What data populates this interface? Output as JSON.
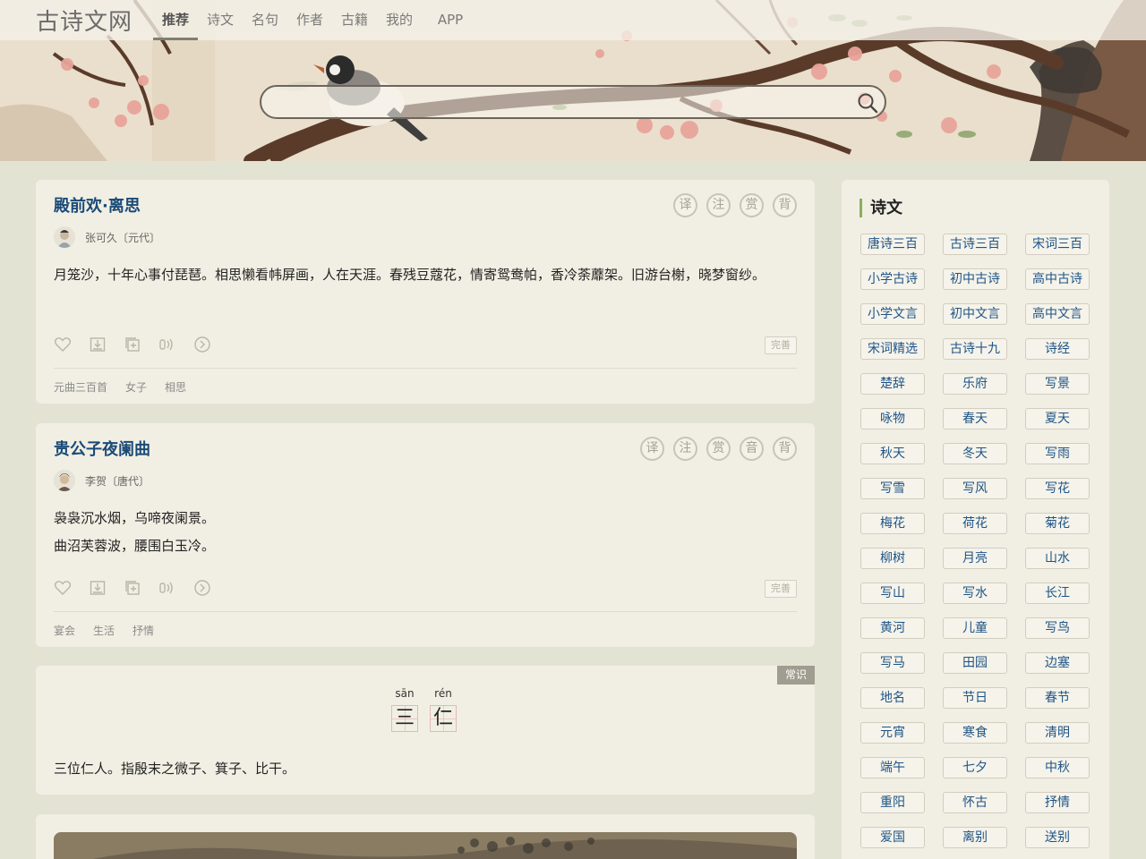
{
  "site": {
    "logo": "古诗文网",
    "search_placeholder": ""
  },
  "nav": [
    {
      "label": "推荐",
      "active": true
    },
    {
      "label": "诗文",
      "active": false
    },
    {
      "label": "名句",
      "active": false
    },
    {
      "label": "作者",
      "active": false
    },
    {
      "label": "古籍",
      "active": false
    },
    {
      "label": "我的",
      "active": false
    },
    {
      "label": "APP",
      "active": false
    }
  ],
  "poems": [
    {
      "title": "殿前欢·离思",
      "author": "张可久〔元代〕",
      "badges": [
        "译",
        "注",
        "赏",
        "背"
      ],
      "lines": [
        "月笼沙，十年心事付琵琶。相思懒看帏屏画，人在天涯。春残豆蔻花，情寄鸳鸯帕，香冷荼蘼架。旧游台榭，晓梦窗纱。"
      ],
      "wanshan": "完善",
      "tags": [
        "元曲三百首",
        "女子",
        "相思"
      ]
    },
    {
      "title": "贵公子夜阑曲",
      "author": "李贺〔唐代〕",
      "badges": [
        "译",
        "注",
        "赏",
        "音",
        "背"
      ],
      "lines": [
        "袅袅沉水烟，乌啼夜阑景。",
        "曲沼芙蓉波，腰围白玉冷。"
      ],
      "wanshan": "完善",
      "tags": [
        "宴会",
        "生活",
        "抒情"
      ]
    }
  ],
  "changshi": {
    "label": "常识",
    "chars": [
      {
        "pinyin": "sān",
        "hanzi": "三"
      },
      {
        "pinyin": "rén",
        "hanzi": "仁"
      }
    ],
    "text": "三位仁人。指殷末之微子、箕子、比干。"
  },
  "sidebar": {
    "title": "诗文",
    "tags": [
      "唐诗三百",
      "古诗三百",
      "宋词三百",
      "小学古诗",
      "初中古诗",
      "高中古诗",
      "小学文言",
      "初中文言",
      "高中文言",
      "宋词精选",
      "古诗十九",
      "诗经",
      "楚辞",
      "乐府",
      "写景",
      "咏物",
      "春天",
      "夏天",
      "秋天",
      "冬天",
      "写雨",
      "写雪",
      "写风",
      "写花",
      "梅花",
      "荷花",
      "菊花",
      "柳树",
      "月亮",
      "山水",
      "写山",
      "写水",
      "长江",
      "黄河",
      "儿童",
      "写鸟",
      "写马",
      "田园",
      "边塞",
      "地名",
      "节日",
      "春节",
      "元宵",
      "寒食",
      "清明",
      "端午",
      "七夕",
      "中秋",
      "重阳",
      "怀古",
      "抒情",
      "爱国",
      "离别",
      "送别"
    ]
  },
  "colors": {
    "title_blue": "#1a4a78",
    "tag_blue": "#1f5487",
    "accent_green": "#8cae5c"
  }
}
